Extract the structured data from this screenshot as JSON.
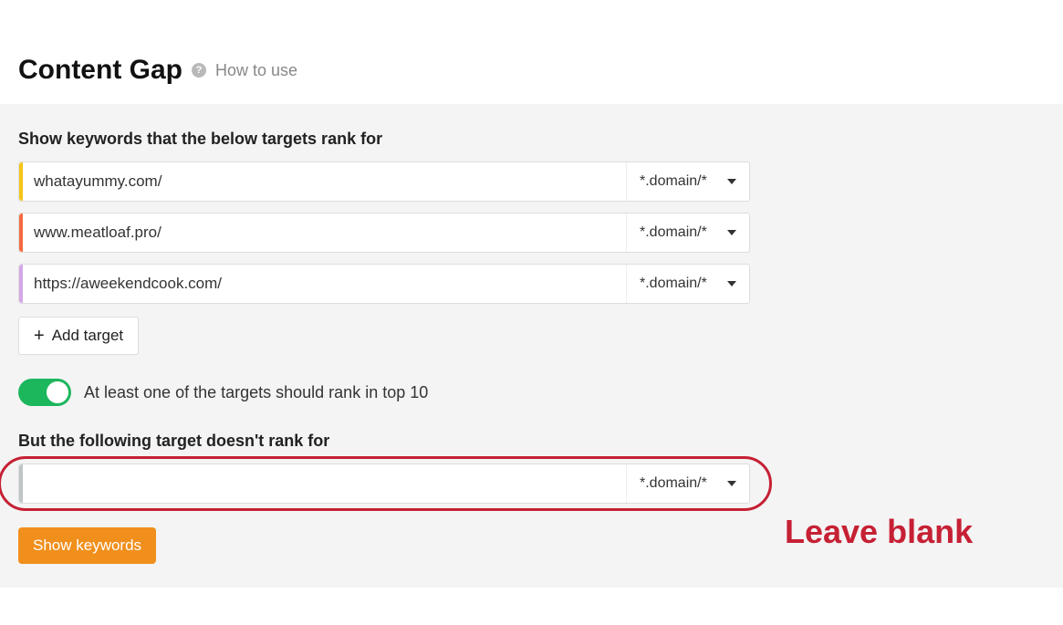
{
  "header": {
    "title": "Content Gap",
    "help_glyph": "?",
    "how_to_use": "How to use"
  },
  "form": {
    "targets_label": "Show keywords that the below targets rank for",
    "domain_mode": "*.domain/*",
    "targets": [
      {
        "value": "whatayummy.com/",
        "color": "yellow"
      },
      {
        "value": "www.meatloaf.pro/",
        "color": "orange"
      },
      {
        "value": "https://aweekendcook.com/",
        "color": "purple"
      }
    ],
    "add_target_label": "Add target",
    "toggle_label": "At least one of the targets should rank in top 10",
    "toggle_on": true,
    "exclude_label": "But the following target doesn't rank for",
    "exclude_value": "",
    "submit_label": "Show keywords"
  },
  "annotation": {
    "text": "Leave blank"
  }
}
